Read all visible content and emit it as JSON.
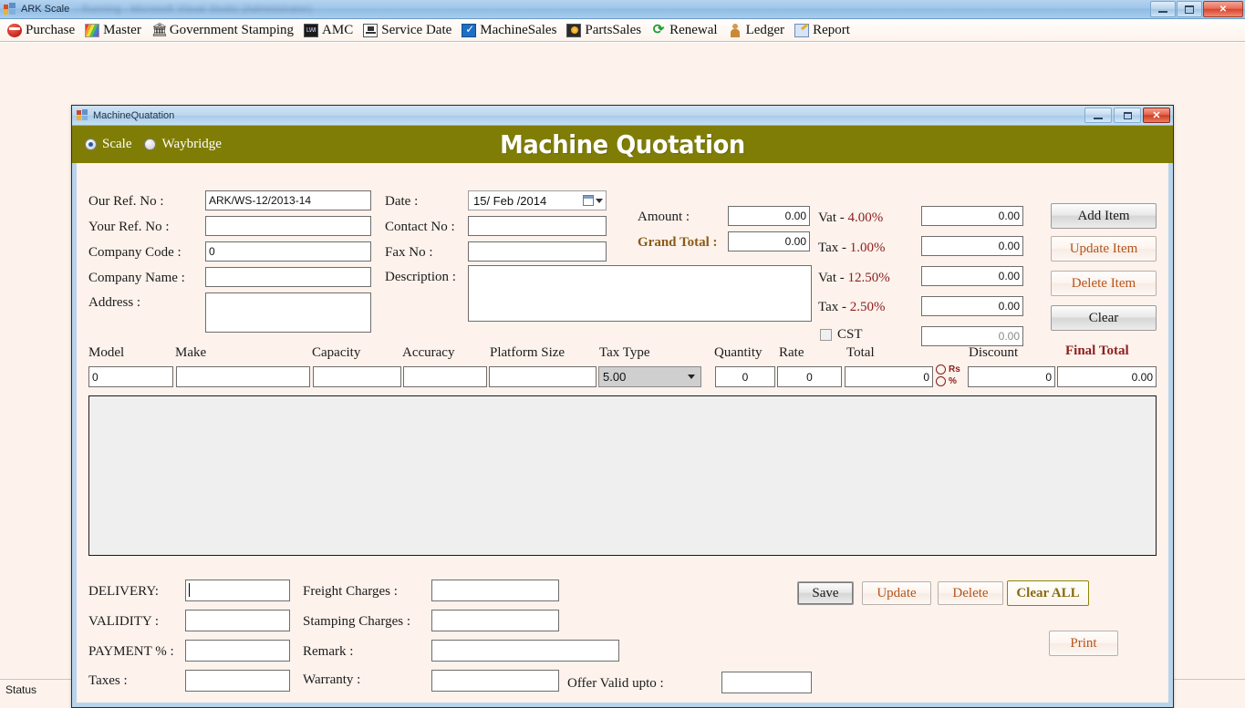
{
  "window": {
    "app_title": "ARK Scale",
    "app_title_blurred": "- Running - Microsoft Visual Studio (Administrator)",
    "minimize": "—",
    "restore": "❐",
    "close": "✕"
  },
  "menubar": {
    "items": [
      {
        "label": "Purchase",
        "icon": "purchase-icon"
      },
      {
        "label": "Master",
        "icon": "master-icon"
      },
      {
        "label": "Government Stamping",
        "icon": "bank-icon"
      },
      {
        "label": "AMC",
        "icon": "amc-icon"
      },
      {
        "label": "Service Date",
        "icon": "service-date-icon"
      },
      {
        "label": "MachineSales",
        "icon": "machine-sales-icon"
      },
      {
        "label": "PartsSales",
        "icon": "parts-sales-icon"
      },
      {
        "label": "Renewal",
        "icon": "renewal-icon"
      },
      {
        "label": "Ledger",
        "icon": "ledger-icon"
      },
      {
        "label": "Report",
        "icon": "report-icon"
      }
    ]
  },
  "mdi": {
    "title": "MachineQuatation",
    "minimize": "—",
    "maximize": "❐",
    "close": "✕"
  },
  "banner": {
    "title": "Machine Quotation",
    "background": "#807d06",
    "radios": [
      {
        "label": "Scale",
        "selected": true
      },
      {
        "label": "Waybridge",
        "selected": false
      }
    ]
  },
  "form": {
    "left_fields": [
      {
        "label": "Our Ref. No :",
        "value": "ARK/WS-12/2013-14"
      },
      {
        "label": "Your Ref. No :",
        "value": ""
      },
      {
        "label": "Company Code :",
        "value": "0"
      },
      {
        "label": "Company Name :",
        "value": ""
      },
      {
        "label": "Address :",
        "value": ""
      }
    ],
    "mid_fields": [
      {
        "label": "Date :",
        "value": "15/ Feb /2014"
      },
      {
        "label": "Contact No :",
        "value": ""
      },
      {
        "label": "Fax No :",
        "value": ""
      },
      {
        "label": "Description :",
        "value": ""
      }
    ],
    "amount_label": "Amount :",
    "amount_value": "0.00",
    "grand_total_label": "Grand Total :",
    "grand_total_value": "0.00",
    "tax_rows": [
      {
        "label": "Vat - ",
        "pct": "4.00%",
        "value": "0.00"
      },
      {
        "label": "Tax - ",
        "pct": "1.00%",
        "value": "0.00"
      },
      {
        "label": "Vat - ",
        "pct": "12.50%",
        "value": "0.00"
      },
      {
        "label": "Tax - ",
        "pct": "2.50%",
        "value": "0.00"
      }
    ],
    "cst_label": "CST",
    "cst_checked": false,
    "cst_value": "0.00",
    "action_buttons": [
      {
        "label": "Add Item",
        "style": "dark"
      },
      {
        "label": "Update Item",
        "style": "light"
      },
      {
        "label": "Delete Item",
        "style": "light"
      },
      {
        "label": "Clear",
        "style": "dark"
      }
    ]
  },
  "item_row": {
    "headers": [
      "Model",
      "Make",
      "Capacity",
      "Accuracy",
      "Platform Size",
      "Tax Type",
      "Quantity",
      "Rate",
      "Total",
      "Discount",
      "Final Total"
    ],
    "values": {
      "model": "0",
      "make": "",
      "capacity": "",
      "accuracy": "",
      "platform_size": "",
      "tax_type": "5.00",
      "quantity": "0",
      "rate": "0",
      "total": "0",
      "discount": "0",
      "final_total": "0.00"
    },
    "discount_modes": [
      {
        "label": "Rs",
        "selected": false
      },
      {
        "label": "%",
        "selected": false
      }
    ]
  },
  "footer": {
    "fields": [
      {
        "label": "DELIVERY:",
        "value": ""
      },
      {
        "label": "VALIDITY :",
        "value": ""
      },
      {
        "label": "PAYMENT % :",
        "value": ""
      },
      {
        "label": "Taxes :",
        "value": ""
      },
      {
        "label": "Freight Charges :",
        "value": ""
      },
      {
        "label": "Stamping Charges :",
        "value": ""
      },
      {
        "label": "Remark :",
        "value": ""
      },
      {
        "label": "Warranty :",
        "value": ""
      },
      {
        "label": "Offer Valid upto :",
        "value": ""
      }
    ],
    "buttons": [
      {
        "label": "Save",
        "style": "dark"
      },
      {
        "label": "Update",
        "style": "light"
      },
      {
        "label": "Delete",
        "style": "light"
      },
      {
        "label": "Clear ALL",
        "style": "clearall"
      },
      {
        "label": "Print",
        "style": "light"
      }
    ]
  },
  "statusbar": {
    "text": "Status"
  }
}
